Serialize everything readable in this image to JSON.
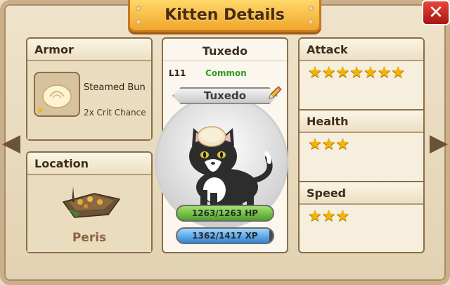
{
  "header": {
    "title": "Kitten Details"
  },
  "armor": {
    "heading": "Armor",
    "item_name": "Steamed Bun",
    "item_effect": "2x Crit Chance"
  },
  "location": {
    "heading": "Location",
    "name": "Peris"
  },
  "kitten": {
    "name_heading": "Tuxedo",
    "level": "L11",
    "rarity": "Common",
    "name_ribbon": "Tuxedo",
    "hp_text": "1263/1263 HP",
    "hp_fraction": 1.0,
    "xp_text": "1362/1417 XP",
    "xp_fraction": 0.961
  },
  "stats": {
    "attack": {
      "heading": "Attack",
      "stars": 7
    },
    "health": {
      "heading": "Health",
      "stars": 3
    },
    "speed": {
      "heading": "Speed",
      "stars": 3
    }
  },
  "colors": {
    "hp": "#4f9f2a",
    "xp": "#2f86d8",
    "star": "#f4b400",
    "rarity_common": "#2f9a22"
  },
  "icons": {
    "close": "close-icon",
    "prev": "chevron-left-icon",
    "next": "chevron-right-icon",
    "edit": "pencil-icon"
  }
}
